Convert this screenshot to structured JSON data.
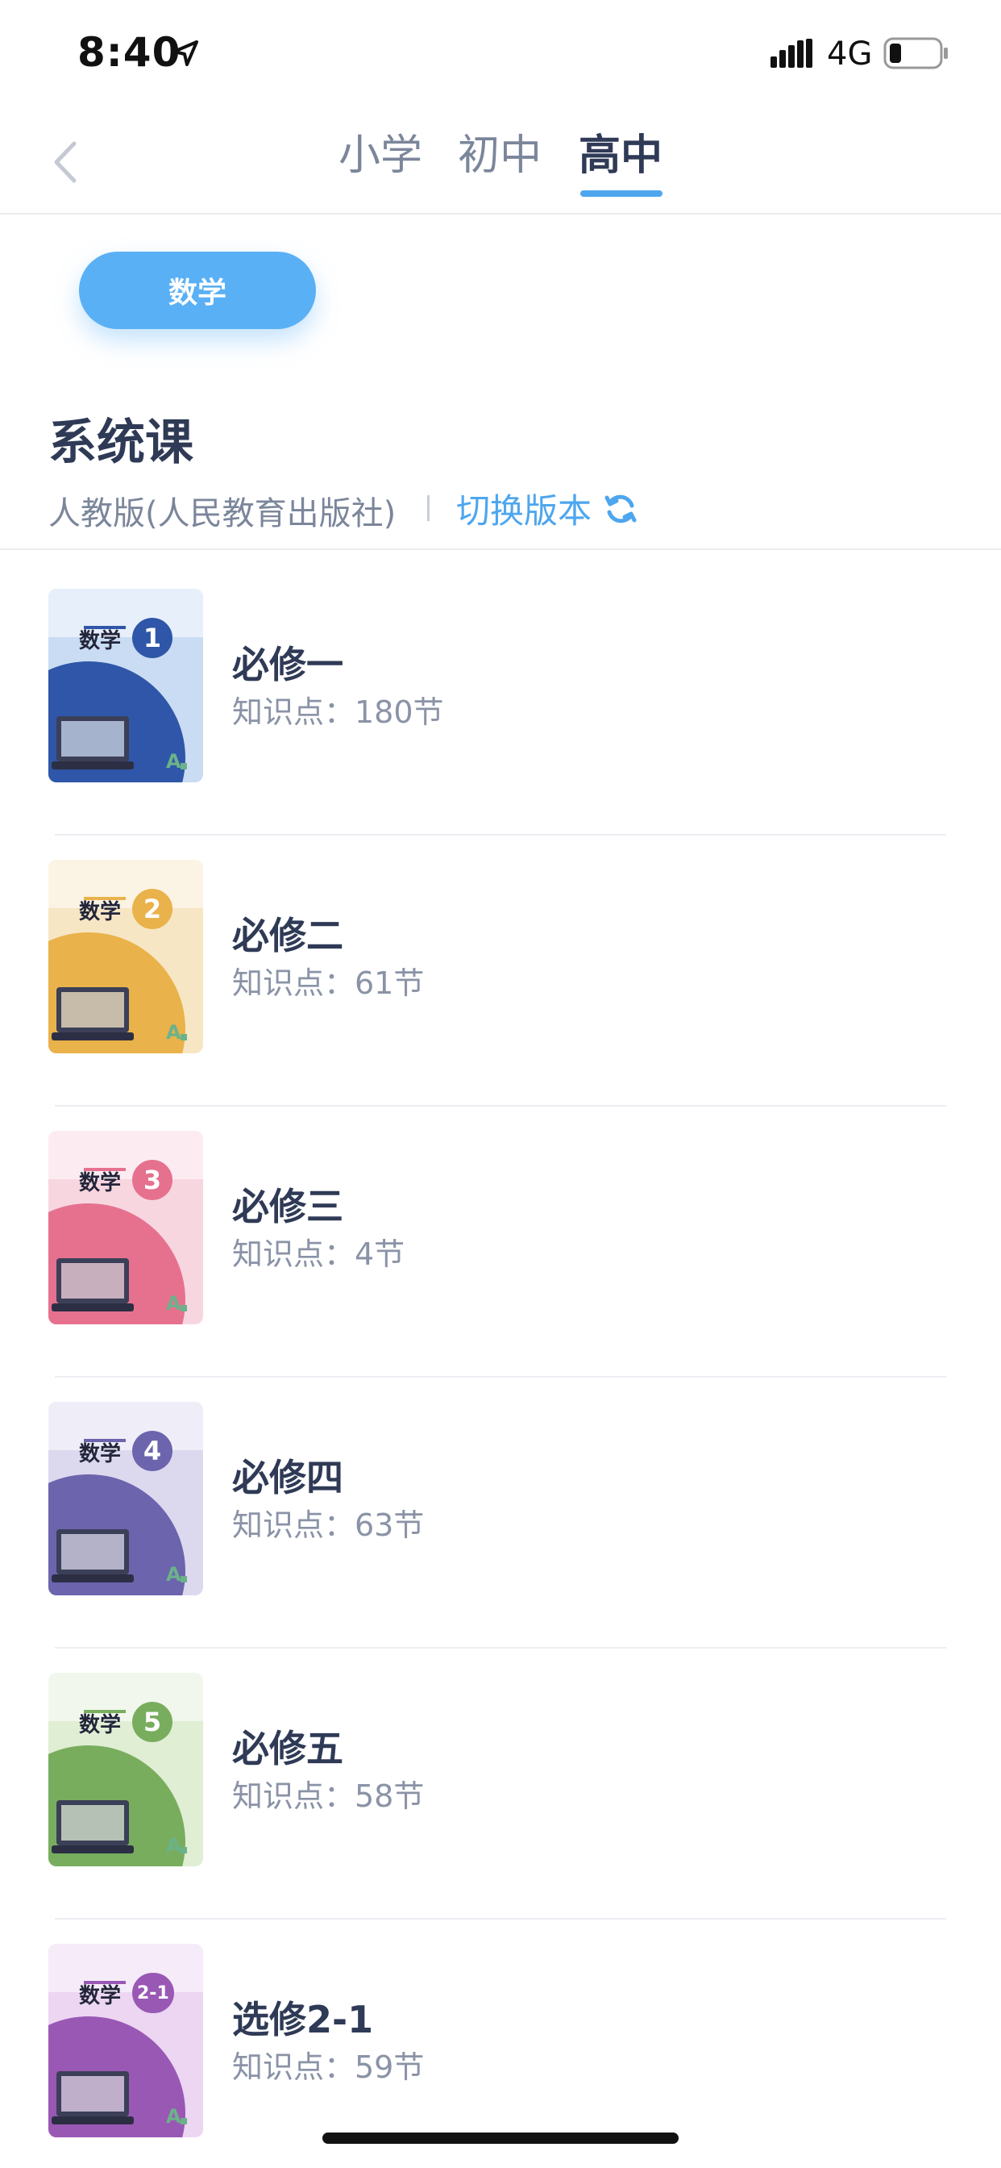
{
  "status_bar": {
    "time": "8:40",
    "network": "4G"
  },
  "tabs": [
    {
      "label": "小学",
      "active": false
    },
    {
      "label": "初中",
      "active": false
    },
    {
      "label": "高中",
      "active": true
    }
  ],
  "subject_chip": "数学",
  "section": {
    "title": "系统课",
    "edition": "人教版(人民教育出版社)",
    "switch_label": "切换版本"
  },
  "courses": [
    {
      "title": "必修一",
      "points": "知识点：180节",
      "cover_label": "数学",
      "cover_badge": "1",
      "color": "#2f56a8",
      "accent": "#c9dcf3"
    },
    {
      "title": "必修二",
      "points": "知识点：61节",
      "cover_label": "数学",
      "cover_badge": "2",
      "color": "#e9b24a",
      "accent": "#f7e6c4"
    },
    {
      "title": "必修三",
      "points": "知识点：4节",
      "cover_label": "数学",
      "cover_badge": "3",
      "color": "#e6718f",
      "accent": "#f8d6e0"
    },
    {
      "title": "必修四",
      "points": "知识点：63节",
      "cover_label": "数学",
      "cover_badge": "4",
      "color": "#6c64ad",
      "accent": "#dcd9ef"
    },
    {
      "title": "必修五",
      "points": "知识点：58节",
      "cover_label": "数学",
      "cover_badge": "5",
      "color": "#79ad5e",
      "accent": "#e0eed4"
    },
    {
      "title": "选修2-1",
      "points": "知识点：59节",
      "cover_label": "数学",
      "cover_badge": "2-1",
      "color": "#9a58b5",
      "accent": "#ecd6f2"
    }
  ],
  "colors": {
    "accent": "#4ea6ee",
    "text_primary": "#2f3a56",
    "text_secondary": "#7b869b"
  },
  "icons": {
    "back": "chevron-left-icon",
    "location": "location-arrow-icon",
    "refresh": "refresh-icon"
  }
}
